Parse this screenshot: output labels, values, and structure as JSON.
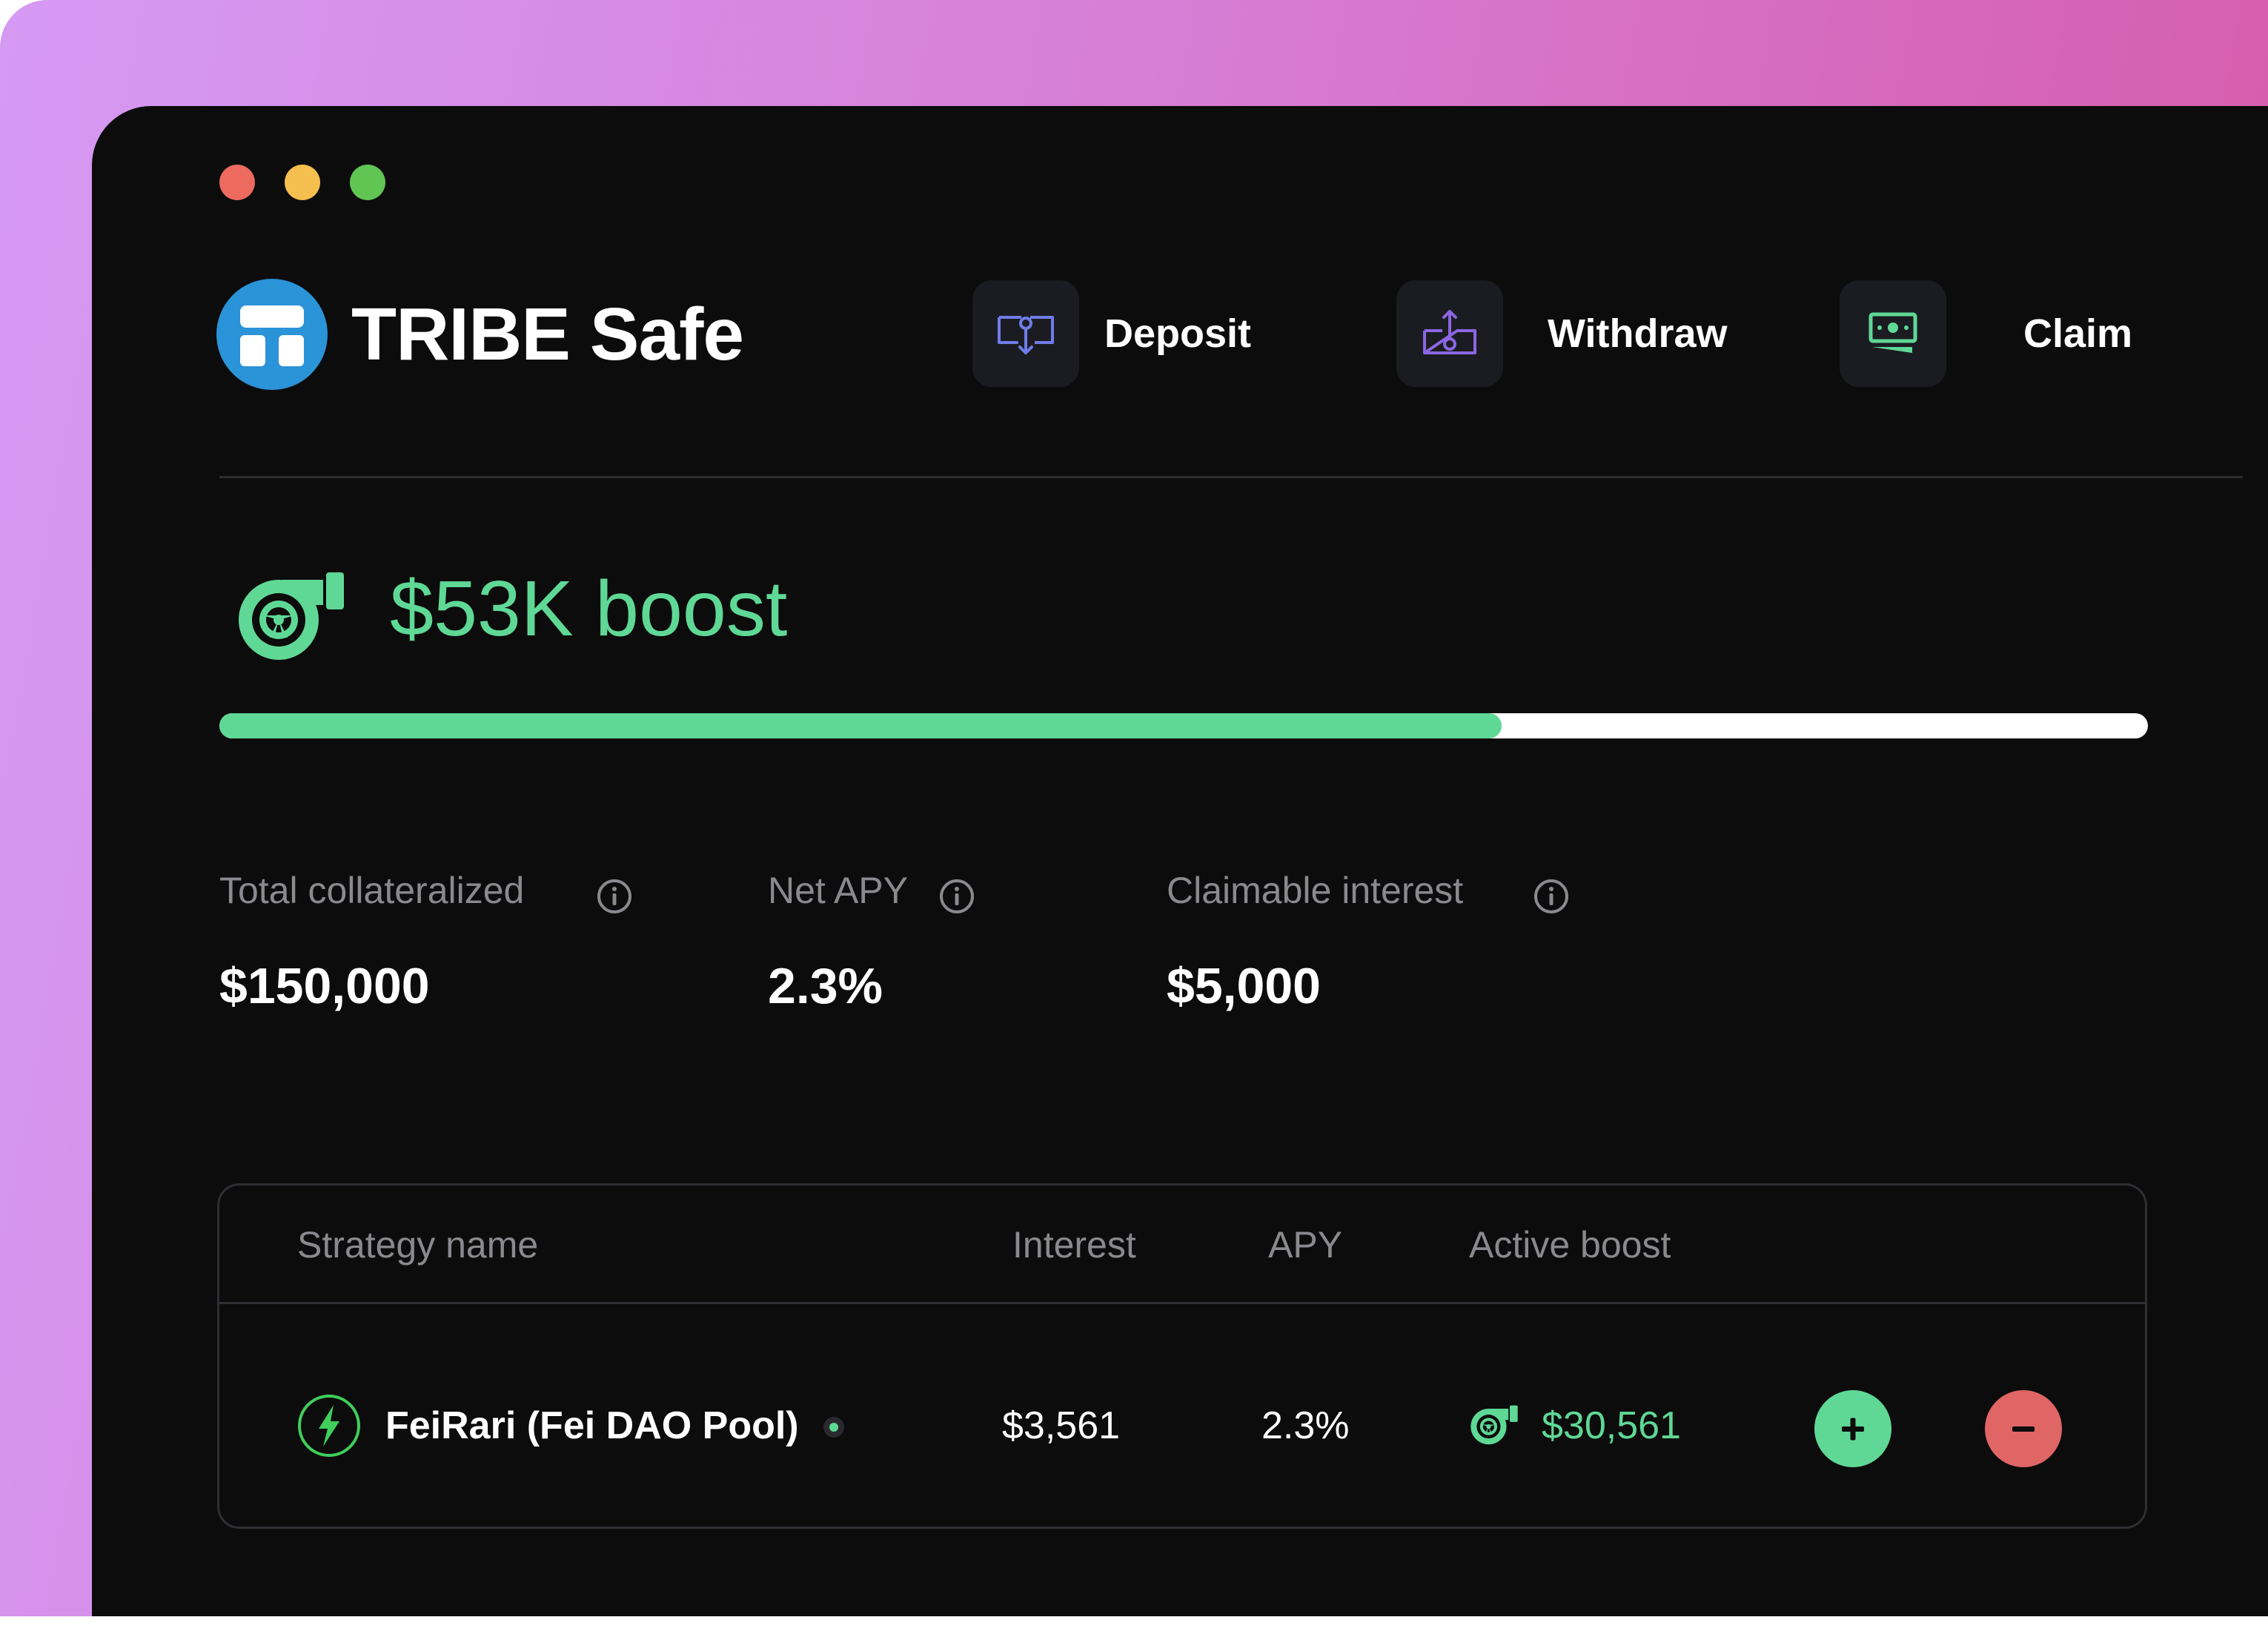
{
  "app": {
    "title": "TRIBE Safe"
  },
  "actions": {
    "deposit_label": "Deposit",
    "withdraw_label": "Withdraw",
    "claim_label": "Claim"
  },
  "boost": {
    "title": "$53K boost",
    "progress_fraction": 0.665
  },
  "stats": [
    {
      "label": "Total collateralized",
      "value": "$150,000"
    },
    {
      "label": "Net APY",
      "value": "2.3%"
    },
    {
      "label": "Claimable interest",
      "value": "$5,000"
    }
  ],
  "table": {
    "headers": {
      "strategy": "Strategy name",
      "interest": "Interest",
      "apy": "APY",
      "boost": "Active boost"
    },
    "rows": [
      {
        "strategy": "FeiRari (Fei DAO Pool)",
        "interest": "$3,561",
        "apy": "2.3%",
        "boost": "$30,561"
      }
    ]
  },
  "icons": {
    "logo": "tribe-logo",
    "deposit": "deposit-icon",
    "withdraw": "withdraw-icon",
    "claim": "cash-icon",
    "boost": "turbo-icon",
    "info": "info-icon",
    "strategy": "lightning-icon",
    "add": "plus-icon",
    "remove": "minus-icon"
  },
  "colors": {
    "accent_green": "#5fd896",
    "danger_red": "#e06565",
    "deposit_icon": "#6f7de8",
    "withdraw_icon": "#8b67e3",
    "window_bg": "#0c0c0c",
    "logo_blue": "#2b93d8"
  }
}
